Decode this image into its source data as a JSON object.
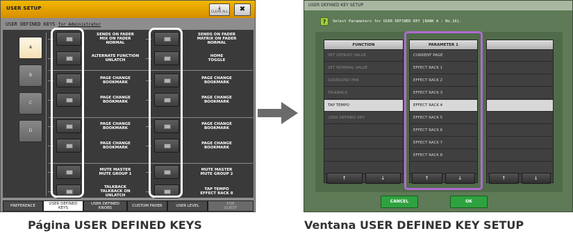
{
  "left_panel": {
    "title": "USER SETUP",
    "clear_all_label": "CLEAR ALL",
    "close_label": "✖",
    "subtitle": "USER DEFINED KEYS",
    "subtitle_for": "for Administrator",
    "banks": [
      "A",
      "B",
      "C",
      "D"
    ],
    "active_bank": "A",
    "keys_left": [
      [
        "SENDS ON FADER",
        "MIX ON FADER",
        "NORMAL"
      ],
      [
        "ALTERNATE FUNCTION",
        "UNLATCH"
      ],
      [
        "PAGE CHANGE",
        "BOOKMARK"
      ],
      [
        "PAGE CHANGE",
        "BOOKMARK"
      ],
      [
        "PAGE CHANGE",
        "BOOKMARK"
      ],
      [
        "PAGE CHANGE",
        "BOOKMARK"
      ],
      [
        "MUTE MASTER",
        "MUTE GROUP 1"
      ],
      [
        "TALKBACK",
        "TALKBACK ON",
        "UNLATCH"
      ]
    ],
    "keys_right": [
      [
        "SENDS ON FADER",
        "MATRIX ON FADER",
        "NORMAL"
      ],
      [
        "HOME",
        "TOGGLE"
      ],
      [
        "PAGE CHANGE",
        "BOOKMARK"
      ],
      [
        "PAGE CHANGE",
        "BOOKMARK"
      ],
      [
        "PAGE CHANGE",
        "BOOKMARK"
      ],
      [
        "PAGE CHANGE",
        "BOOKMARK"
      ],
      [
        "MUTE MASTER",
        "MUTE GROUP 2"
      ],
      [
        "TAP TEMPO",
        "EFFECT RACK 8"
      ]
    ],
    "tabs": [
      {
        "label": [
          "PREFERENCE"
        ],
        "state": "normal"
      },
      {
        "label": [
          "USER DEFINED",
          "KEYS"
        ],
        "state": "active"
      },
      {
        "label": [
          "USER DEFINED",
          "KNOBS"
        ],
        "state": "normal"
      },
      {
        "label": [
          "CUSTOM FADER"
        ],
        "state": "normal"
      },
      {
        "label": [
          "USER LEVEL"
        ],
        "state": "normal"
      },
      {
        "label": [
          "FOR",
          "GUEST"
        ],
        "state": "disabled"
      }
    ]
  },
  "right_panel": {
    "title": "USER DEFINED KEY SETUP",
    "instruction": "Select Parameters for USER DEFINED KEY [BANK A : No.16].",
    "help_icon_label": "?",
    "columns": [
      {
        "header": "FUNCTION",
        "items": [
          "SET DEFAULT VALUE",
          "SET NOMINAL VALUE",
          "SURROUND PAN",
          "TALKBACK",
          "TAP TEMPO",
          "USER DEFINED KEY",
          "",
          "",
          "",
          ""
        ],
        "dim": [
          0,
          1,
          2,
          3,
          5
        ],
        "selected": 4
      },
      {
        "header": "PARAMETER 1",
        "items": [
          "CURRENT PAGE",
          "EFFECT RACK 1",
          "EFFECT RACK 2",
          "EFFECT RACK 3",
          "EFFECT RACK 4",
          "EFFECT RACK 5",
          "EFFECT RACK 6",
          "EFFECT RACK 7",
          "EFFECT RACK 8",
          ""
        ],
        "dim": [],
        "selected": 4
      },
      {
        "header": "",
        "items": [
          "",
          "",
          "",
          "",
          "",
          "",
          "",
          "",
          "",
          ""
        ],
        "dim": [],
        "selected": 4
      }
    ],
    "scroll_up_label": "↑",
    "scroll_down_label": "↓",
    "cancel_label": "CANCEL",
    "ok_label": "OK"
  },
  "captions": {
    "left": "Página USER DEFINED KEYS",
    "right": "Ventana USER DEFINED KEY SETUP"
  },
  "colors": {
    "title_bar_orange": "#e8a400",
    "dialog_green": "#5e7a56",
    "highlight_purple": "#b06ad2",
    "button_green": "#2fa240",
    "selected_row": "#d8d8d8"
  }
}
